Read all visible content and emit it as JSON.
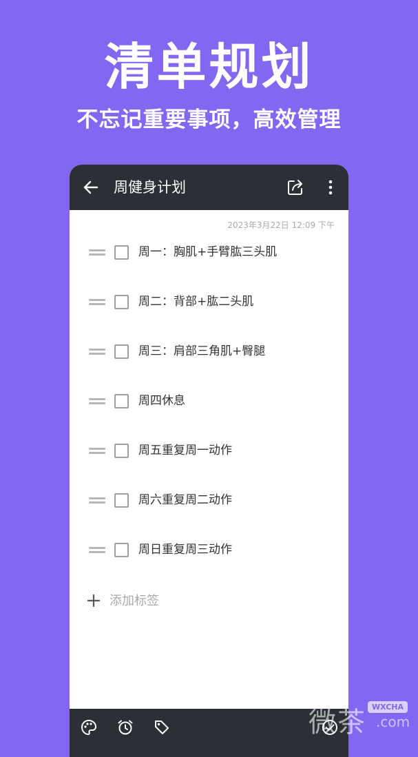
{
  "promo": {
    "title": "清单规划",
    "subtitle": "不忘记重要事项，高效管理"
  },
  "topbar": {
    "title": "周健身计划",
    "icons": [
      "back-arrow-icon",
      "share-icon",
      "more-vertical-icon"
    ]
  },
  "note": {
    "timestamp": "2023年3月22日 12:09 下午",
    "items": [
      {
        "text": "周一：胸肌+手臂肱三头肌",
        "checked": false
      },
      {
        "text": "周二：背部+肱二头肌",
        "checked": false
      },
      {
        "text": "周三：肩部三角肌+臀腿",
        "checked": false
      },
      {
        "text": "周四休息",
        "checked": false
      },
      {
        "text": "周五重复周一动作",
        "checked": false
      },
      {
        "text": "周六重复周二动作",
        "checked": false
      },
      {
        "text": "周日重复周三动作",
        "checked": false
      }
    ],
    "add_tag_label": "添加标签"
  },
  "bottombar": {
    "icons": [
      "palette-icon",
      "alarm-icon",
      "tag-icon",
      "check-circle-icon"
    ]
  },
  "watermark": {
    "text": "微茶",
    "badge": "WXCHA",
    "suffix": ".com"
  },
  "colors": {
    "background": "#8467F0",
    "bar": "#2B2F36"
  }
}
